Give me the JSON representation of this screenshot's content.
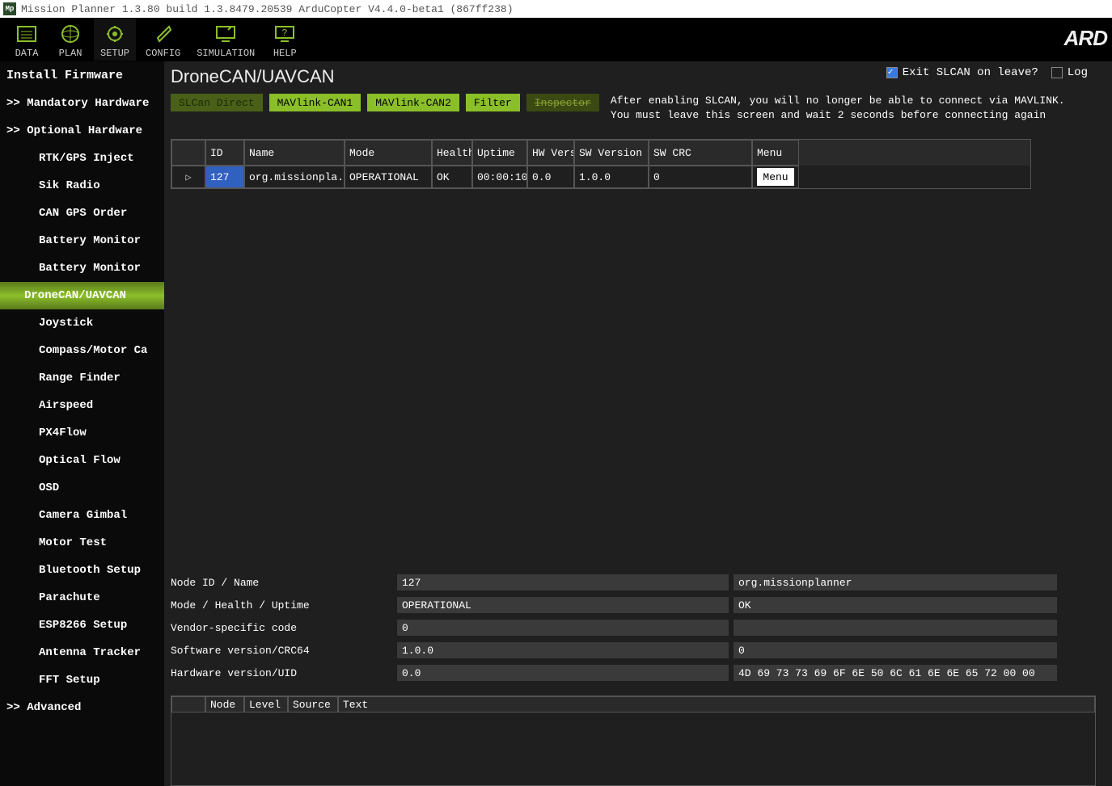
{
  "titlebar": {
    "icon_text": "Mp",
    "text": "Mission Planner 1.3.80 build 1.3.8479.20539 ArduCopter V4.4.0-beta1 (867ff238)"
  },
  "topnav": {
    "items": [
      {
        "label": "DATA"
      },
      {
        "label": "PLAN"
      },
      {
        "label": "SETUP"
      },
      {
        "label": "CONFIG"
      },
      {
        "label": "SIMULATION"
      },
      {
        "label": "HELP"
      }
    ],
    "logo": "ARD"
  },
  "sidebar": {
    "items": [
      {
        "label": "Install Firmware",
        "type": "top"
      },
      {
        "label": ">> Mandatory Hardware",
        "type": "cat"
      },
      {
        "label": ">> Optional Hardware",
        "type": "cat"
      },
      {
        "label": "RTK/GPS Inject",
        "type": "sub"
      },
      {
        "label": "Sik Radio",
        "type": "sub"
      },
      {
        "label": "CAN GPS Order",
        "type": "sub"
      },
      {
        "label": "Battery Monitor",
        "type": "sub"
      },
      {
        "label": "Battery Monitor",
        "type": "sub"
      },
      {
        "label": "DroneCAN/UAVCAN",
        "type": "active"
      },
      {
        "label": "Joystick",
        "type": "sub"
      },
      {
        "label": "Compass/Motor Ca",
        "type": "sub"
      },
      {
        "label": "Range Finder",
        "type": "sub"
      },
      {
        "label": "Airspeed",
        "type": "sub"
      },
      {
        "label": "PX4Flow",
        "type": "sub"
      },
      {
        "label": "Optical Flow",
        "type": "sub"
      },
      {
        "label": "OSD",
        "type": "sub"
      },
      {
        "label": "Camera Gimbal",
        "type": "sub"
      },
      {
        "label": "Motor Test",
        "type": "sub"
      },
      {
        "label": "Bluetooth Setup",
        "type": "sub"
      },
      {
        "label": "Parachute",
        "type": "sub"
      },
      {
        "label": "ESP8266 Setup",
        "type": "sub"
      },
      {
        "label": "Antenna Tracker",
        "type": "sub"
      },
      {
        "label": "FFT Setup",
        "type": "sub"
      },
      {
        "label": ">> Advanced",
        "type": "cat"
      }
    ]
  },
  "page": {
    "title": "DroneCAN/UAVCAN",
    "exit_slcan_label": "Exit SLCAN on leave?",
    "exit_slcan_checked": true,
    "log_label": "Log",
    "log_checked": false,
    "buttons": {
      "slcan_direct": "SLCan Direct",
      "mavlink_can1": "MAVlink-CAN1",
      "mavlink_can2": "MAVlink-CAN2",
      "filter": "Filter",
      "inspector": "Inspector"
    },
    "after_text_1": "After enabling SLCAN, you will no longer be able to connect via MAVLINK.",
    "after_text_2": "You must leave this screen and wait 2 seconds before connecting again"
  },
  "grid": {
    "headers": {
      "id": "ID",
      "name": "Name",
      "mode": "Mode",
      "health": "Health",
      "uptime": "Uptime",
      "hw": "HW Version",
      "sw": "SW Version",
      "crc": "SW CRC",
      "menu": "Menu"
    },
    "row": {
      "arrow": "▷",
      "id": "127",
      "name": "org.missionpla...",
      "mode": "OPERATIONAL",
      "health": "OK",
      "uptime": "00:00:10",
      "hw": "0.0",
      "sw": "1.0.0",
      "crc": "0",
      "menu": "Menu"
    }
  },
  "details": {
    "rows": [
      {
        "label": "Node ID / Name",
        "v1": "127",
        "v2": "org.missionplanner"
      },
      {
        "label": "Mode / Health / Uptime",
        "v1": "OPERATIONAL",
        "v2": "OK"
      },
      {
        "label": "Vendor-specific code",
        "v1": "0",
        "v2": ""
      },
      {
        "label": "Software version/CRC64",
        "v1": "1.0.0",
        "v2": "0"
      },
      {
        "label": "Hardware version/UID",
        "v1": "0.0",
        "v2": "4D 69 73 73 69 6F 6E 50 6C 61 6E 6E 65 72 00 00"
      }
    ]
  },
  "log_grid": {
    "headers": {
      "node": "Node",
      "level": "Level",
      "source": "Source",
      "text": "Text"
    }
  }
}
